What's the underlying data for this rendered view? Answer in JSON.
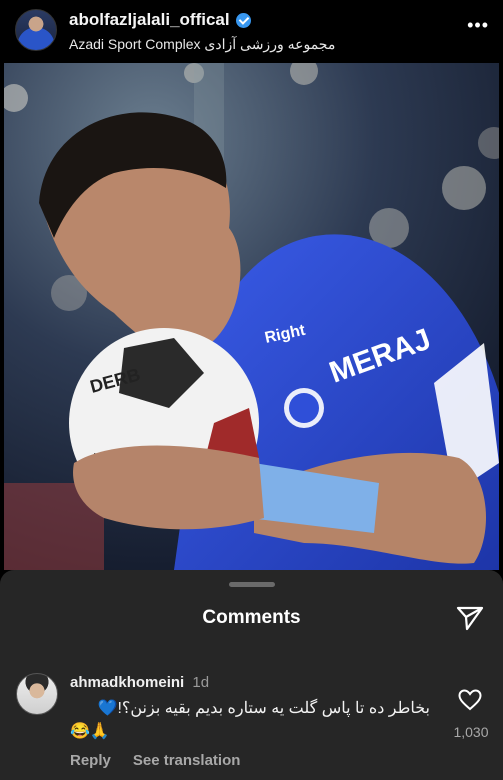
{
  "post": {
    "username": "abolfazljalali_offical",
    "location": "Azadi Sport Complex  مجموعه ورزشی آزادی",
    "more_icon": "more-horizontal-icon",
    "photo": {
      "ball_text": "DERB",
      "jersey_sponsor": "MERAJ",
      "jersey_text": "Right"
    }
  },
  "comments_sheet": {
    "title": "Comments",
    "send_icon": "send-icon",
    "comments": [
      {
        "username": "ahmadkhomeini",
        "time": "1d",
        "text": "بخاطر ده تا پاس گلت یه ستاره بدیم بقیه بزنن؟!💙",
        "emoji_line": "😂🙏",
        "reply_label": "Reply",
        "translate_label": "See translation",
        "like_count": "1,030"
      }
    ]
  },
  "colors": {
    "background": "#000000",
    "sheet": "#262626",
    "verified": "#3897f0",
    "jersey_blue": "#2f4fd8",
    "muted_text": "#a8a8a8"
  }
}
